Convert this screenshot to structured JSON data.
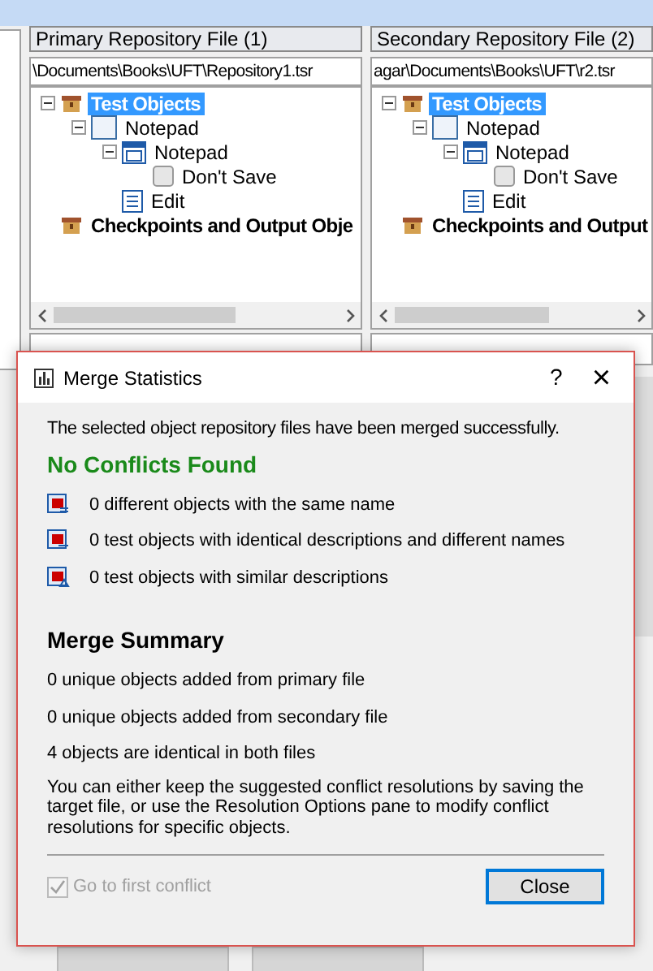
{
  "panels": [
    {
      "title": "Primary Repository File (1)",
      "path": "\\Documents\\Books\\UFT\\Repository1.tsr",
      "tree": [
        {
          "label": "Test Objects",
          "kind": "folder",
          "expanded": true,
          "selected": true,
          "children": [
            {
              "label": "Notepad",
              "kind": "window",
              "expanded": true,
              "selected": false,
              "children": [
                {
                  "label": "Notepad",
                  "kind": "dialog",
                  "expanded": true,
                  "selected": false,
                  "children": [
                    {
                      "label": "Don't Save",
                      "kind": "button",
                      "selected": false
                    }
                  ]
                },
                {
                  "label": "Edit",
                  "kind": "edit",
                  "selected": false
                }
              ]
            }
          ]
        },
        {
          "label": "Checkpoints and Output Obje",
          "kind": "folder",
          "selected": false
        }
      ]
    },
    {
      "title": "Secondary Repository File (2)",
      "path": "agar\\Documents\\Books\\UFT\\r2.tsr",
      "tree": [
        {
          "label": "Test Objects",
          "kind": "folder",
          "expanded": true,
          "selected": true,
          "children": [
            {
              "label": "Notepad",
              "kind": "window",
              "expanded": true,
              "selected": false,
              "children": [
                {
                  "label": "Notepad",
                  "kind": "dialog",
                  "expanded": true,
                  "selected": false,
                  "children": [
                    {
                      "label": "Don't Save",
                      "kind": "button",
                      "selected": false
                    }
                  ]
                },
                {
                  "label": "Edit",
                  "kind": "edit",
                  "selected": false
                }
              ]
            }
          ]
        },
        {
          "label": "Checkpoints and Output",
          "kind": "folder",
          "selected": false
        }
      ]
    }
  ],
  "dialog": {
    "title": "Merge Statistics",
    "help": "?",
    "close": "×",
    "message": "The selected object repository files have been merged successfully.",
    "status": "No Conflicts Found",
    "stats": [
      {
        "kind": "same-name",
        "text": "0 different objects with the same name"
      },
      {
        "kind": "identical",
        "text": "0 test objects with identical descriptions and different names"
      },
      {
        "kind": "similar",
        "text": "0 test objects with similar descriptions"
      }
    ],
    "summary_title": "Merge Summary",
    "summary": [
      "0 unique objects added from primary file",
      "0 unique objects added from secondary file",
      "4 objects are identical in both files"
    ],
    "note": "You can either keep the suggested conflict resolutions by saving the target file, or use the Resolution Options pane to modify conflict resolutions for specific objects.",
    "checkbox": {
      "label": "Go to first conflict",
      "checked": true,
      "disabled": true
    },
    "button": {
      "label": "Close",
      "default": true
    }
  }
}
